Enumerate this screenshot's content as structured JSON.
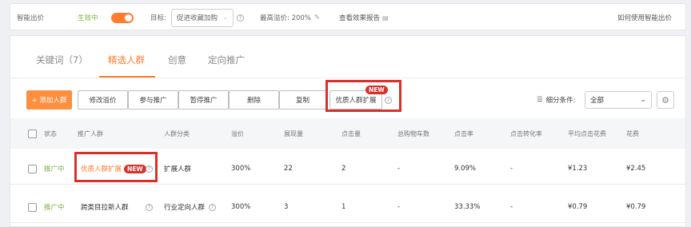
{
  "topbar": {
    "smart_bid_label": "智能出价",
    "status": "生效中",
    "goal_label": "目标:",
    "goal_value": "促进收藏加购",
    "max_premium_label": "最高溢价: 200%",
    "view_report": "查看效果报告",
    "how_to_use": "如何使用智能出价"
  },
  "tabs": [
    {
      "label": "关键词（7）"
    },
    {
      "label": "精选人群"
    },
    {
      "label": "创意"
    },
    {
      "label": "定向推广"
    }
  ],
  "toolbar": {
    "add_crowd": "+ 添加人群",
    "modify_premium": "修改溢价",
    "join_promo": "参与推广",
    "pause_promo": "暂停推广",
    "delete": "删除",
    "copy": "复制",
    "quality_expand": "优质人群扩展",
    "new_badge": "NEW",
    "filter_label": "细分条件:",
    "filter_value": "全部"
  },
  "table": {
    "headers": [
      "状态",
      "推广人群",
      "人群分类",
      "溢价",
      "展现量",
      "点击量",
      "总购物车数",
      "点击率",
      "点击转化率",
      "平均点击花费",
      "花费"
    ],
    "rows": [
      {
        "status": "推广中",
        "crowd": "优质人群扩展",
        "badge": "NEW",
        "category": "扩展人群",
        "premium": "300%",
        "impressions": "22",
        "clicks": "2",
        "carts": "-",
        "ctr": "9.09%",
        "cvr": "-",
        "avg_cpc": "¥1.23",
        "cost": "¥2.45"
      },
      {
        "status": "推广中",
        "crowd": "跨类目拉新人群",
        "badge": "",
        "category": "行业定向人群",
        "premium": "300%",
        "impressions": "3",
        "clicks": "1",
        "carts": "-",
        "ctr": "33.33%",
        "cvr": "-",
        "avg_cpc": "¥0.79",
        "cost": "¥0.79"
      }
    ]
  },
  "colors": {
    "accent": "#ff7b2e",
    "highlight": "#d9302b",
    "active_status": "#7cb342"
  }
}
